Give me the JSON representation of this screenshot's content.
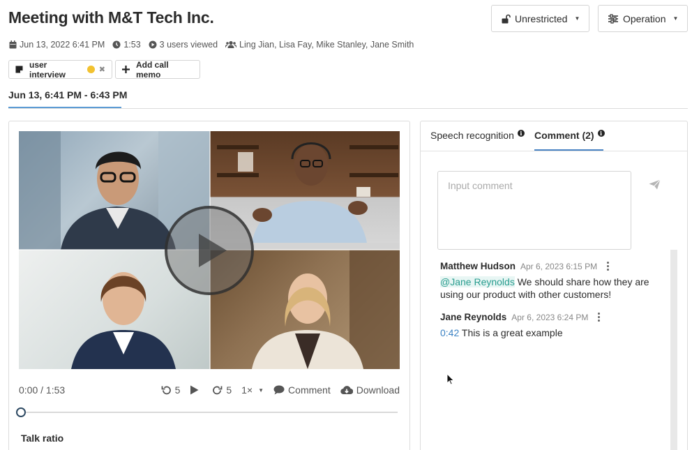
{
  "header": {
    "title": "Meeting with M&T Tech Inc.",
    "access_button": "Unrestricted",
    "operation_button": "Operation"
  },
  "meta": {
    "date": "Jun 13, 2022 6:41 PM",
    "duration": "1:53",
    "views": "3 users viewed",
    "participants": "Ling Jian, Lisa Fay, Mike Stanley, Jane Smith"
  },
  "chips": {
    "tag_label": "user interview",
    "memo_label": "Add call memo"
  },
  "range_tab": "Jun 13, 6:41 PM - 6:43 PM",
  "player": {
    "time": "0:00 / 1:53",
    "rewind": "5",
    "forward": "5",
    "speed": "1×",
    "comment": "Comment",
    "download": "Download",
    "progress": 0
  },
  "talk_ratio_label": "Talk ratio",
  "right_tabs": {
    "speech": "Speech recognition",
    "comment": "Comment (2)"
  },
  "comment_input": {
    "placeholder": "Input comment"
  },
  "comments": [
    {
      "author": "Matthew Hudson",
      "date": "Apr 6, 2023 6:15 PM",
      "mention": "@Jane Reynolds",
      "text": " We should share how they are using our product with other customers!"
    },
    {
      "author": "Jane Reynolds",
      "date": "Apr 6, 2023 6:24 PM",
      "timestamp": "0:42",
      "text": " This is a great example"
    }
  ],
  "colors": {
    "accent": "#4a84c4",
    "mention": "#2a9d8f",
    "timestamp": "#3b82c4"
  }
}
